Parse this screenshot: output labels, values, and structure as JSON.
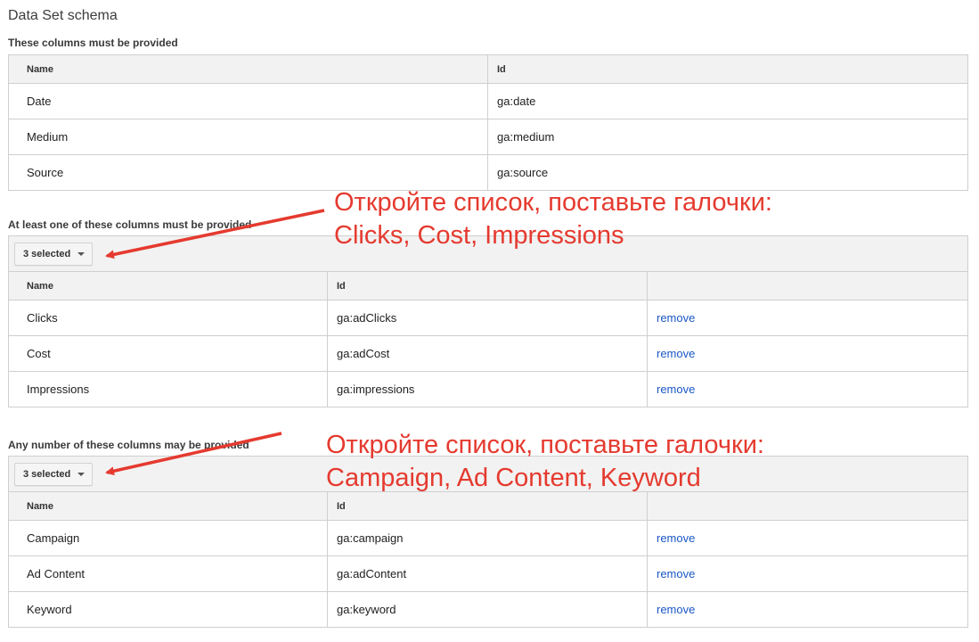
{
  "page": {
    "title": "Data Set schema"
  },
  "required": {
    "label": "These columns must be provided",
    "headers": {
      "name": "Name",
      "id": "Id"
    },
    "rows": [
      {
        "name": "Date",
        "id": "ga:date"
      },
      {
        "name": "Medium",
        "id": "ga:medium"
      },
      {
        "name": "Source",
        "id": "ga:source"
      }
    ]
  },
  "metrics": {
    "label": "At least one of these columns must be provided",
    "dropdown_label": "3 selected",
    "headers": {
      "name": "Name",
      "id": "Id"
    },
    "remove_label": "remove",
    "rows": [
      {
        "name": "Clicks",
        "id": "ga:adClicks"
      },
      {
        "name": "Cost",
        "id": "ga:adCost"
      },
      {
        "name": "Impressions",
        "id": "ga:impressions"
      }
    ]
  },
  "optional": {
    "label": "Any number of these columns may be provided",
    "dropdown_label": "3 selected",
    "headers": {
      "name": "Name",
      "id": "Id"
    },
    "remove_label": "remove",
    "rows": [
      {
        "name": "Campaign",
        "id": "ga:campaign"
      },
      {
        "name": "Ad Content",
        "id": "ga:adContent"
      },
      {
        "name": "Keyword",
        "id": "ga:keyword"
      }
    ]
  },
  "annotations": {
    "first": {
      "line1": "Откройте список, поставьте галочки:",
      "line2": "Clicks, Cost, Impressions"
    },
    "second": {
      "line1": "Откройте список, поставьте галочки:",
      "line2": "Campaign, Ad Content, Keyword"
    }
  },
  "colors": {
    "annotation": "#e53a2f",
    "link": "#1a57c6",
    "header_bg": "#f2f2f2"
  }
}
